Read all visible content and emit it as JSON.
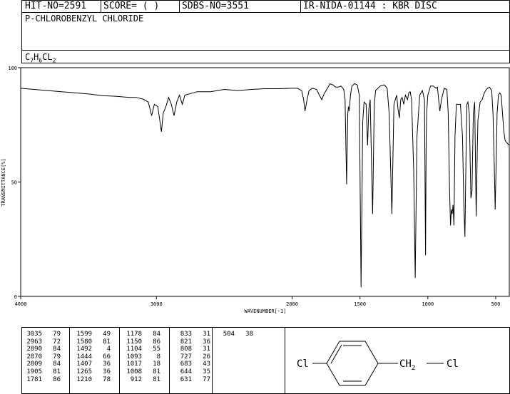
{
  "header": {
    "hit_no": "HIT-NO=2591",
    "score": "SCORE=  (   )",
    "sdbs_no": "SDBS-NO=3551",
    "ir_info": "IR-NIDA-01144 : KBR DISC"
  },
  "compound": {
    "name": "P-CHLOROBENZYL CHLORIDE",
    "formula": {
      "c": "C",
      "c_n": "7",
      "h": "H",
      "h_n": "6",
      "cl": "CL",
      "cl_n": "2"
    }
  },
  "chart_data": {
    "type": "line",
    "title": "",
    "xlabel": "WAVENUMBER[-1]",
    "ylabel": "TRANSMITTANCE[%]",
    "xlim": [
      4000,
      400
    ],
    "ylim": [
      0,
      100
    ],
    "x_reversed": true,
    "xticks": [
      4000,
      3000,
      2000,
      1500,
      1000,
      500
    ],
    "yticks": [
      0,
      50,
      100
    ],
    "grid": false,
    "legend": "none",
    "series": [
      {
        "color": "#000000",
        "points": [
          [
            4000,
            91
          ],
          [
            3900,
            90.5
          ],
          [
            3800,
            90
          ],
          [
            3700,
            89.5
          ],
          [
            3600,
            89
          ],
          [
            3500,
            88.5
          ],
          [
            3400,
            87.8
          ],
          [
            3300,
            87.5
          ],
          [
            3200,
            87
          ],
          [
            3150,
            87
          ],
          [
            3100,
            86.3
          ],
          [
            3060,
            85
          ],
          [
            3035,
            79
          ],
          [
            3015,
            84
          ],
          [
            2990,
            83
          ],
          [
            2975,
            77
          ],
          [
            2963,
            72
          ],
          [
            2950,
            80
          ],
          [
            2930,
            83
          ],
          [
            2910,
            87
          ],
          [
            2890,
            84
          ],
          [
            2870,
            79
          ],
          [
            2850,
            85
          ],
          [
            2830,
            88
          ],
          [
            2809,
            84
          ],
          [
            2790,
            88
          ],
          [
            2700,
            89.5
          ],
          [
            2600,
            89.5
          ],
          [
            2500,
            90.5
          ],
          [
            2400,
            90
          ],
          [
            2300,
            90.5
          ],
          [
            2200,
            90.8
          ],
          [
            2100,
            90.8
          ],
          [
            2000,
            91
          ],
          [
            1960,
            91
          ],
          [
            1930,
            90
          ],
          [
            1915,
            86
          ],
          [
            1905,
            81
          ],
          [
            1890,
            86
          ],
          [
            1875,
            90
          ],
          [
            1850,
            91
          ],
          [
            1820,
            90.5
          ],
          [
            1800,
            88
          ],
          [
            1781,
            86
          ],
          [
            1765,
            88.5
          ],
          [
            1740,
            91
          ],
          [
            1720,
            93
          ],
          [
            1700,
            92.5
          ],
          [
            1680,
            91.5
          ],
          [
            1660,
            91.5
          ],
          [
            1640,
            92
          ],
          [
            1620,
            90.5
          ],
          [
            1610,
            86
          ],
          [
            1599,
            49
          ],
          [
            1590,
            80
          ],
          [
            1585,
            83
          ],
          [
            1580,
            81
          ],
          [
            1570,
            88
          ],
          [
            1560,
            92
          ],
          [
            1540,
            93
          ],
          [
            1520,
            92.5
          ],
          [
            1505,
            88
          ],
          [
            1492,
            4
          ],
          [
            1480,
            76
          ],
          [
            1470,
            85
          ],
          [
            1455,
            84
          ],
          [
            1444,
            66
          ],
          [
            1435,
            82
          ],
          [
            1425,
            86
          ],
          [
            1407,
            36
          ],
          [
            1395,
            84
          ],
          [
            1385,
            90
          ],
          [
            1350,
            92
          ],
          [
            1320,
            92.5
          ],
          [
            1300,
            91
          ],
          [
            1285,
            80
          ],
          [
            1265,
            36
          ],
          [
            1250,
            84
          ],
          [
            1230,
            88
          ],
          [
            1220,
            82
          ],
          [
            1210,
            78
          ],
          [
            1200,
            86
          ],
          [
            1190,
            87
          ],
          [
            1178,
            84
          ],
          [
            1165,
            88
          ],
          [
            1150,
            86
          ],
          [
            1140,
            89
          ],
          [
            1130,
            89.5
          ],
          [
            1120,
            86
          ],
          [
            1104,
            55
          ],
          [
            1093,
            8
          ],
          [
            1080,
            70
          ],
          [
            1060,
            88
          ],
          [
            1040,
            90
          ],
          [
            1025,
            86
          ],
          [
            1017,
            18
          ],
          [
            1012,
            70
          ],
          [
            1008,
            81
          ],
          [
            1000,
            88
          ],
          [
            980,
            92
          ],
          [
            960,
            92
          ],
          [
            940,
            91
          ],
          [
            930,
            91.5
          ],
          [
            912,
            81
          ],
          [
            900,
            86
          ],
          [
            880,
            91
          ],
          [
            860,
            90.5
          ],
          [
            850,
            80
          ],
          [
            840,
            46
          ],
          [
            833,
            31
          ],
          [
            827,
            38
          ],
          [
            821,
            36
          ],
          [
            814,
            40
          ],
          [
            808,
            31
          ],
          [
            800,
            70
          ],
          [
            790,
            84
          ],
          [
            775,
            84
          ],
          [
            760,
            84
          ],
          [
            745,
            70
          ],
          [
            735,
            40
          ],
          [
            727,
            26
          ],
          [
            718,
            65
          ],
          [
            712,
            84
          ],
          [
            705,
            85
          ],
          [
            695,
            80
          ],
          [
            683,
            43
          ],
          [
            675,
            46
          ],
          [
            665,
            80
          ],
          [
            655,
            85
          ],
          [
            644,
            35
          ],
          [
            637,
            60
          ],
          [
            631,
            77
          ],
          [
            625,
            80
          ],
          [
            615,
            85
          ],
          [
            600,
            86
          ],
          [
            590,
            88
          ],
          [
            575,
            90
          ],
          [
            560,
            91
          ],
          [
            545,
            91.5
          ],
          [
            530,
            90
          ],
          [
            520,
            80
          ],
          [
            510,
            55
          ],
          [
            504,
            38
          ],
          [
            498,
            55
          ],
          [
            490,
            80
          ],
          [
            480,
            88
          ],
          [
            470,
            89
          ],
          [
            460,
            88
          ],
          [
            450,
            80
          ],
          [
            440,
            72
          ],
          [
            430,
            68
          ],
          [
            415,
            67
          ],
          [
            400,
            66
          ]
        ]
      }
    ]
  },
  "peak_table": {
    "columns": [
      [
        [
          "3035",
          "79"
        ],
        [
          "2963",
          "72"
        ],
        [
          "2890",
          "84"
        ],
        [
          "2870",
          "79"
        ],
        [
          "2809",
          "84"
        ],
        [
          "1905",
          "81"
        ],
        [
          "1781",
          "86"
        ]
      ],
      [
        [
          "1599",
          "49"
        ],
        [
          "1580",
          "81"
        ],
        [
          "1492",
          "4"
        ],
        [
          "1444",
          "66"
        ],
        [
          "1407",
          "36"
        ],
        [
          "1265",
          "36"
        ],
        [
          "1210",
          "78"
        ]
      ],
      [
        [
          "1178",
          "84"
        ],
        [
          "1150",
          "86"
        ],
        [
          "1104",
          "55"
        ],
        [
          "1093",
          "8"
        ],
        [
          "1017",
          "18"
        ],
        [
          "1008",
          "81"
        ],
        [
          "912",
          "81"
        ]
      ],
      [
        [
          "833",
          "31"
        ],
        [
          "821",
          "36"
        ],
        [
          "808",
          "31"
        ],
        [
          "727",
          "26"
        ],
        [
          "683",
          "43"
        ],
        [
          "644",
          "35"
        ],
        [
          "631",
          "77"
        ]
      ],
      [
        [
          "504",
          "38"
        ]
      ]
    ]
  },
  "structure": {
    "left_atom": "Cl",
    "right_group": "CH",
    "right_sub": "2",
    "right_atom": "Cl"
  }
}
